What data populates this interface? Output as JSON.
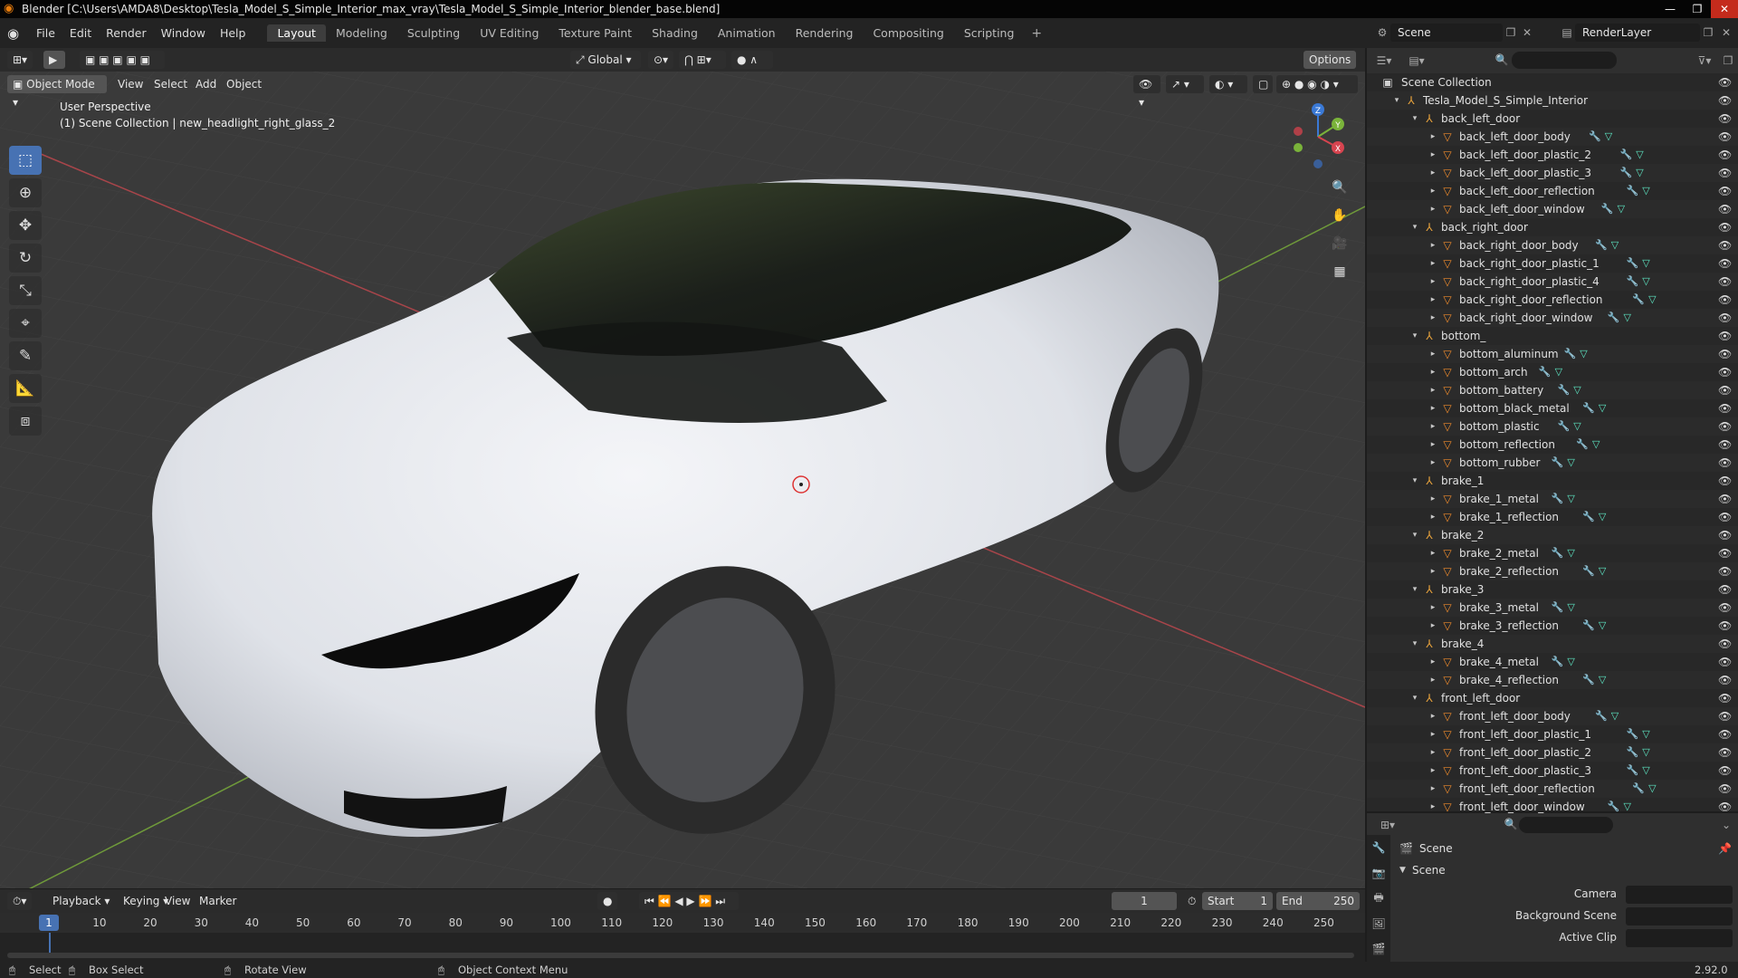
{
  "window": {
    "title": "Blender [C:\\Users\\AMDA8\\Desktop\\Tesla_Model_S_Simple_Interior_max_vray\\Tesla_Model_S_Simple_Interior_blender_base.blend]",
    "min_glyph": "—",
    "max_glyph": "❐",
    "close_glyph": "✕"
  },
  "menus": [
    "File",
    "Edit",
    "Render",
    "Window",
    "Help"
  ],
  "workspaces": [
    "Layout",
    "Modeling",
    "Sculpting",
    "UV Editing",
    "Texture Paint",
    "Shading",
    "Animation",
    "Rendering",
    "Compositing",
    "Scripting"
  ],
  "active_workspace": "Layout",
  "add_workspace": "+",
  "scene_name": "Scene",
  "render_layer": "RenderLayer",
  "viewport": {
    "mode": "Object Mode",
    "menus": [
      "View",
      "Select",
      "Add",
      "Object"
    ],
    "orientation": "Global",
    "options_label": "Options",
    "perspective": "User Perspective",
    "context": "(1) Scene Collection | new_headlight_right_glass_2",
    "axis_x": "X",
    "axis_y": "Y",
    "axis_z": "Z"
  },
  "outliner": {
    "search_placeholder": "",
    "root": "Scene Collection",
    "rows": [
      {
        "label": "Tesla_Model_S_Simple_Interior",
        "kind": "empty",
        "depth": 1
      },
      {
        "label": "back_left_door",
        "kind": "empty",
        "depth": 2
      },
      {
        "label": "back_left_door_body",
        "kind": "mesh",
        "depth": 3
      },
      {
        "label": "back_left_door_plastic_2",
        "kind": "mesh",
        "depth": 3
      },
      {
        "label": "back_left_door_plastic_3",
        "kind": "mesh",
        "depth": 3
      },
      {
        "label": "back_left_door_reflection",
        "kind": "mesh",
        "depth": 3
      },
      {
        "label": "back_left_door_window",
        "kind": "mesh",
        "depth": 3
      },
      {
        "label": "back_right_door",
        "kind": "empty",
        "depth": 2
      },
      {
        "label": "back_right_door_body",
        "kind": "mesh",
        "depth": 3
      },
      {
        "label": "back_right_door_plastic_1",
        "kind": "mesh",
        "depth": 3
      },
      {
        "label": "back_right_door_plastic_4",
        "kind": "mesh",
        "depth": 3
      },
      {
        "label": "back_right_door_reflection",
        "kind": "mesh",
        "depth": 3
      },
      {
        "label": "back_right_door_window",
        "kind": "mesh",
        "depth": 3
      },
      {
        "label": "bottom_",
        "kind": "empty",
        "depth": 2
      },
      {
        "label": "bottom_aluminum",
        "kind": "mesh",
        "depth": 3
      },
      {
        "label": "bottom_arch",
        "kind": "mesh",
        "depth": 3
      },
      {
        "label": "bottom_battery",
        "kind": "mesh",
        "depth": 3
      },
      {
        "label": "bottom_black_metal",
        "kind": "mesh",
        "depth": 3
      },
      {
        "label": "bottom_plastic",
        "kind": "mesh",
        "depth": 3
      },
      {
        "label": "bottom_reflection",
        "kind": "mesh",
        "depth": 3
      },
      {
        "label": "bottom_rubber",
        "kind": "mesh",
        "depth": 3
      },
      {
        "label": "brake_1",
        "kind": "empty",
        "depth": 2
      },
      {
        "label": "brake_1_metal",
        "kind": "mesh",
        "depth": 3
      },
      {
        "label": "brake_1_reflection",
        "kind": "mesh",
        "depth": 3
      },
      {
        "label": "brake_2",
        "kind": "empty",
        "depth": 2
      },
      {
        "label": "brake_2_metal",
        "kind": "mesh",
        "depth": 3
      },
      {
        "label": "brake_2_reflection",
        "kind": "mesh",
        "depth": 3
      },
      {
        "label": "brake_3",
        "kind": "empty",
        "depth": 2
      },
      {
        "label": "brake_3_metal",
        "kind": "mesh",
        "depth": 3
      },
      {
        "label": "brake_3_reflection",
        "kind": "mesh",
        "depth": 3
      },
      {
        "label": "brake_4",
        "kind": "empty",
        "depth": 2
      },
      {
        "label": "brake_4_metal",
        "kind": "mesh",
        "depth": 3
      },
      {
        "label": "brake_4_reflection",
        "kind": "mesh",
        "depth": 3
      },
      {
        "label": "front_left_door",
        "kind": "empty",
        "depth": 2
      },
      {
        "label": "front_left_door_body",
        "kind": "mesh",
        "depth": 3
      },
      {
        "label": "front_left_door_plastic_1",
        "kind": "mesh",
        "depth": 3
      },
      {
        "label": "front_left_door_plastic_2",
        "kind": "mesh",
        "depth": 3
      },
      {
        "label": "front_left_door_plastic_3",
        "kind": "mesh",
        "depth": 3
      },
      {
        "label": "front_left_door_reflection",
        "kind": "mesh",
        "depth": 3
      },
      {
        "label": "front_left_door_window",
        "kind": "mesh",
        "depth": 3
      }
    ]
  },
  "properties": {
    "header": "Scene",
    "panel": "Scene",
    "fields": [
      {
        "label": "Camera"
      },
      {
        "label": "Background Scene"
      },
      {
        "label": "Active Clip"
      }
    ]
  },
  "timeline": {
    "menus": [
      "Playback",
      "Keying",
      "View",
      "Marker"
    ],
    "current_frame": "1",
    "start_label": "Start",
    "start": "1",
    "end_label": "End",
    "end": "250",
    "ticks": [
      "10",
      "20",
      "30",
      "40",
      "50",
      "60",
      "70",
      "80",
      "90",
      "100",
      "110",
      "120",
      "130",
      "140",
      "150",
      "160",
      "170",
      "180",
      "190",
      "200",
      "210",
      "220",
      "230",
      "240",
      "250"
    ],
    "playhead_label": "1"
  },
  "statusbar": {
    "select": "Select",
    "box_select": "Box Select",
    "rotate_view": "Rotate View",
    "context_menu": "Object Context Menu",
    "version": "2.92.0"
  },
  "colors": {
    "accent": "#4772b3",
    "collection_orange": "#e8a33c",
    "mesh_orange": "#ef8b2c",
    "wrench_blue": "#74a5e6",
    "vertex_green": "#5ee8c5",
    "car_white": "#eceef2"
  }
}
